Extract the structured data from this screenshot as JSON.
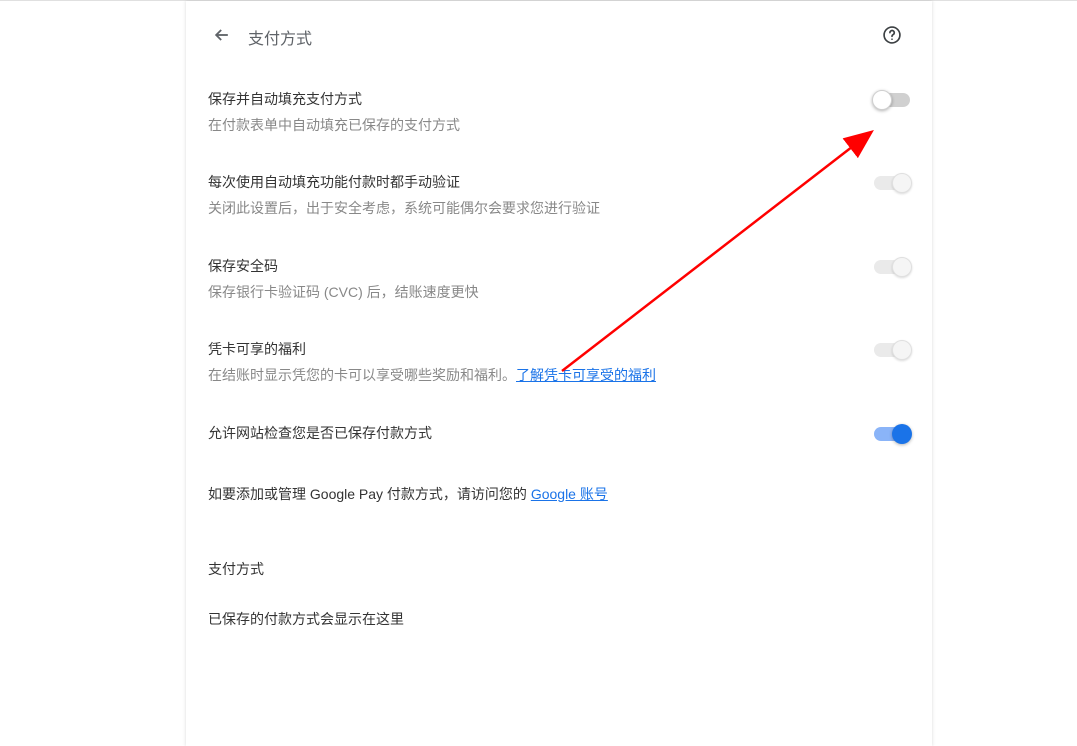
{
  "header": {
    "title": "支付方式"
  },
  "settings": {
    "save_fill": {
      "title": "保存并自动填充支付方式",
      "desc": "在付款表单中自动填充已保存的支付方式",
      "toggle_state": "off"
    },
    "verify": {
      "title": "每次使用自动填充功能付款时都手动验证",
      "desc": "关闭此设置后，出于安全考虑，系统可能偶尔会要求您进行验证",
      "toggle_state": "on-disabled"
    },
    "save_cvc": {
      "title": "保存安全码",
      "desc": "保存银行卡验证码 (CVC) 后，结账速度更快",
      "toggle_state": "on-disabled"
    },
    "card_benefits": {
      "title": "凭卡可享的福利",
      "desc_prefix": "在结账时显示凭您的卡可以享受哪些奖励和福利。",
      "desc_link": "了解凭卡可享受的福利",
      "toggle_state": "on-disabled"
    },
    "allow_site_check": {
      "title": "允许网站检查您是否已保存付款方式",
      "toggle_state": "on"
    }
  },
  "gpay": {
    "prefix": "如要添加或管理 Google Pay 付款方式，请访问您的 ",
    "link": "Google 账号"
  },
  "subheading": "支付方式",
  "saved_empty": "已保存的付款方式会显示在这里"
}
